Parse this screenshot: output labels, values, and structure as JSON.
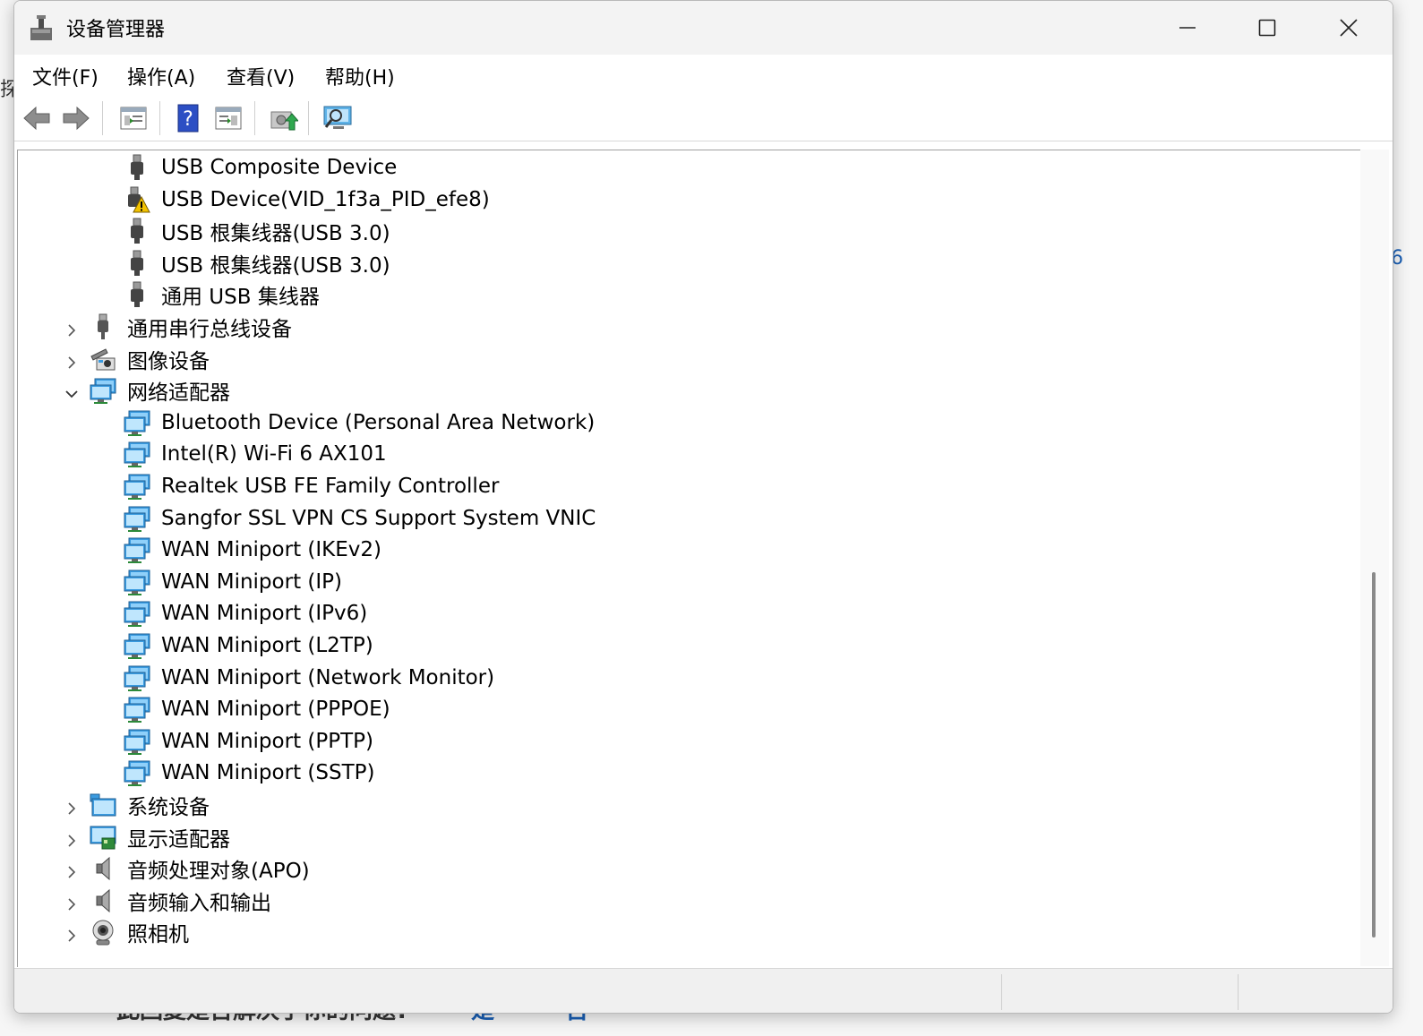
{
  "window": {
    "title": "设备管理器"
  },
  "background_fragments": {
    "left_char": "探",
    "right_char": "6",
    "bottom_text": "此回复是否解决了你的问题?",
    "bottom_yes": "是",
    "bottom_no": "否"
  },
  "menu": {
    "file": "文件(F)",
    "action": "操作(A)",
    "view": "查看(V)",
    "help": "帮助(H)"
  },
  "toolbar": {
    "icons": [
      "back-arrow-icon",
      "forward-arrow-icon",
      "properties-icon",
      "help-icon",
      "view-icon",
      "update-driver-icon",
      "scan-hardware-icon"
    ]
  },
  "tree": {
    "usb_children": [
      {
        "label": "USB Composite Device",
        "icon": "usb-plug-icon"
      },
      {
        "label": "USB Device(VID_1f3a_PID_efe8)",
        "icon": "usb-warning-icon"
      },
      {
        "label": "USB 根集线器(USB 3.0)",
        "icon": "usb-plug-icon"
      },
      {
        "label": "USB 根集线器(USB 3.0)",
        "icon": "usb-plug-icon"
      },
      {
        "label": "通用 USB 集线器",
        "icon": "usb-plug-icon"
      }
    ],
    "category_serial": "通用串行总线设备",
    "category_imaging": "图像设备",
    "category_network": "网络适配器",
    "network_children": [
      "Bluetooth Device (Personal Area Network)",
      "Intel(R) Wi-Fi 6 AX101",
      "Realtek USB FE Family Controller",
      "Sangfor SSL VPN CS Support System VNIC",
      "WAN Miniport (IKEv2)",
      "WAN Miniport (IP)",
      "WAN Miniport (IPv6)",
      "WAN Miniport (L2TP)",
      "WAN Miniport (Network Monitor)",
      "WAN Miniport (PPPOE)",
      "WAN Miniport (PPTP)",
      "WAN Miniport (SSTP)"
    ],
    "category_system": "系统设备",
    "category_display": "显示适配器",
    "category_apo": "音频处理对象(APO)",
    "category_audio_io": "音频输入和输出",
    "category_camera": "照相机"
  }
}
